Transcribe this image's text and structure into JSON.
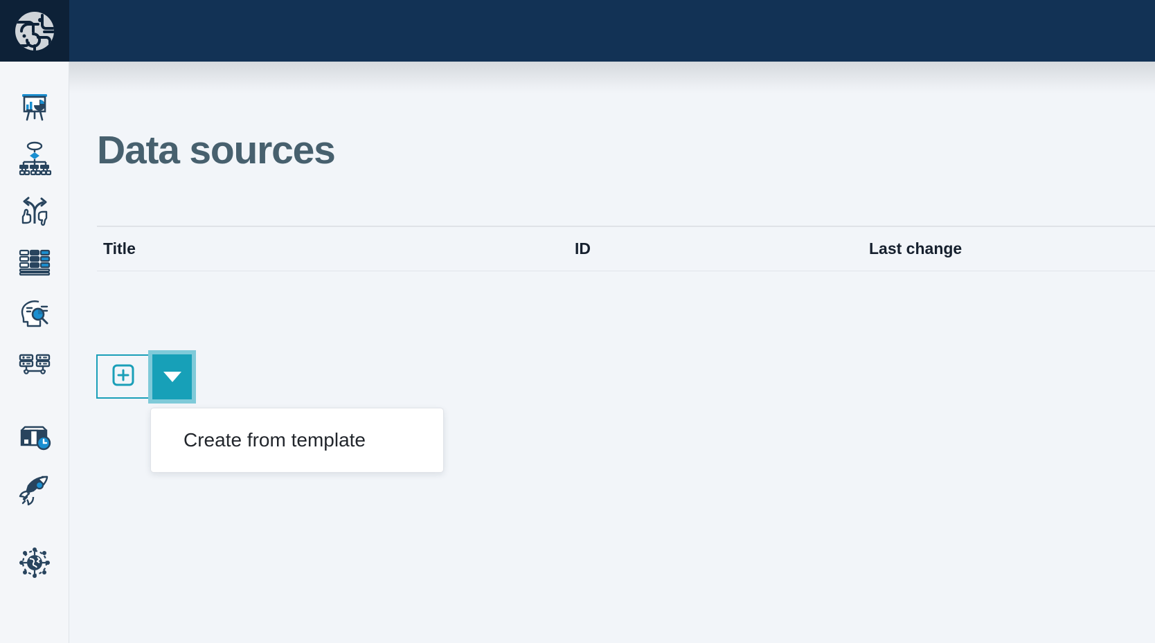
{
  "app": {
    "logo_icon": "globe-maze-logo",
    "brand_navy": "#123255",
    "logo_navy": "#0d2137",
    "accent_teal": "#17a0b8",
    "focus_teal": "#7fcad9",
    "page_background": "#f2f5f9"
  },
  "sidebar": {
    "items": [
      {
        "icon": "presentation-chart-icon",
        "name": "sidebar-item-dashboards"
      },
      {
        "icon": "hierarchy-org-chart-icon",
        "name": "sidebar-item-models"
      },
      {
        "icon": "decision-thumbs-icon",
        "name": "sidebar-item-decisions"
      },
      {
        "icon": "database-table-icon",
        "name": "sidebar-item-data"
      },
      {
        "icon": "head-insight-search-icon",
        "name": "sidebar-item-insights"
      },
      {
        "icon": "server-network-icon",
        "name": "sidebar-item-servers"
      },
      {
        "icon": "box-clock-icon",
        "name": "sidebar-item-history"
      },
      {
        "icon": "rocket-icon",
        "name": "sidebar-item-deploy"
      },
      {
        "icon": "globe-network-icon",
        "name": "sidebar-item-global"
      }
    ]
  },
  "main": {
    "title": "Data sources",
    "table": {
      "columns": [
        {
          "key": "title",
          "label": "Title"
        },
        {
          "key": "id",
          "label": "ID"
        },
        {
          "key": "last_change",
          "label": "Last change"
        }
      ],
      "rows": []
    },
    "create_button": {
      "icon": "plus-square-icon",
      "name": "create-data-source-button"
    },
    "caret_button": {
      "icon": "chevron-down-icon",
      "name": "create-dropdown-toggle"
    },
    "dropdown": {
      "open": true,
      "items": [
        {
          "label": "Create from template"
        }
      ]
    }
  }
}
